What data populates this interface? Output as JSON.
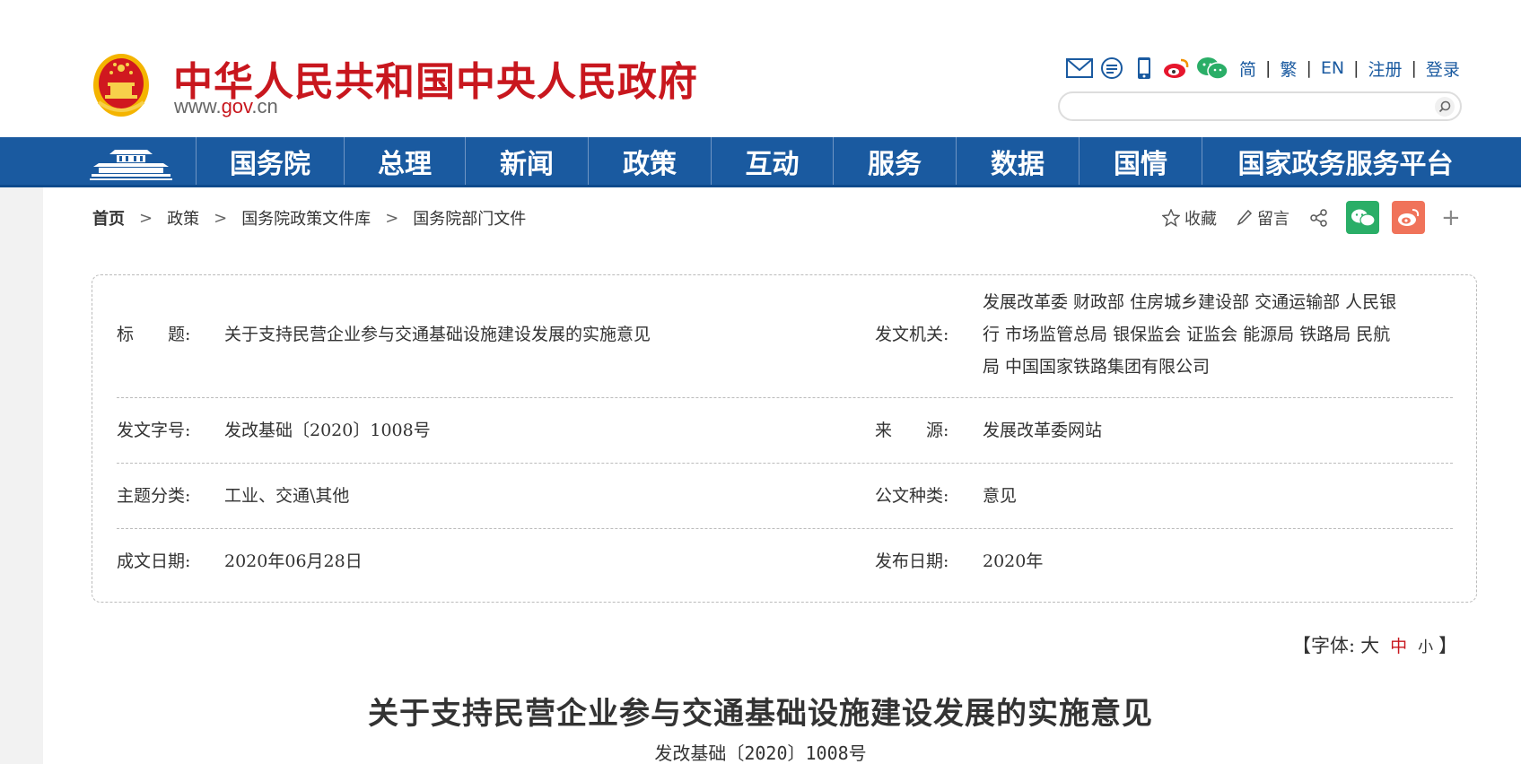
{
  "header": {
    "site_title": "中华人民共和国中央人民政府",
    "site_url_pre": "www.",
    "site_url_brand": "gov",
    "site_url_post": ".cn",
    "search_placeholder": "",
    "tools": [
      "mail-icon",
      "message-icon",
      "mobile-icon",
      "weibo-icon",
      "wechat-icon"
    ],
    "links": {
      "simplified": "简",
      "traditional": "繁",
      "english": "EN",
      "register": "注册",
      "login": "登录"
    },
    "accent_color": "#c8171e",
    "link_color": "#1a5aa0"
  },
  "nav": {
    "color": "#1a5aa0",
    "items": [
      "国务院",
      "总理",
      "新闻",
      "政策",
      "互动",
      "服务",
      "数据",
      "国情",
      "国家政务服务平台"
    ]
  },
  "breadcrumb": [
    "首页",
    "政策",
    "国务院政策文件库",
    "国务院部门文件"
  ],
  "share": {
    "favorite": "收藏",
    "comment": "留言"
  },
  "info": {
    "title_label": "标　　题:",
    "title_value": "关于支持民营企业参与交通基础设施建设发展的实施意见",
    "issuer_label": "发文机关:",
    "issuer_lines": [
      "发展改革委  财政部  住房城乡建设部  交通运输部  人民银",
      "行  市场监管总局  银保监会  证监会  能源局  铁路局  民航",
      "局  中国国家铁路集团有限公司"
    ],
    "docno_label": "发文字号:",
    "docno_value": "发改基础〔2020〕1008号",
    "source_label": "来　　源:",
    "source_value": "发展改革委网站",
    "topic_label": "主题分类:",
    "topic_value": "工业、交通\\其他",
    "type_label": "公文种类:",
    "type_value": "意见",
    "written_label": "成文日期:",
    "written_value": "2020年06月28日",
    "published_label": "发布日期:",
    "published_value": "2020年"
  },
  "font_size": {
    "open": "【字体:",
    "large": "大",
    "medium": "中",
    "small": "小",
    "close": "】"
  },
  "document": {
    "title": "关于支持民营企业参与交通基础设施建设发展的实施意见",
    "number": "发改基础〔2020〕1008号"
  }
}
